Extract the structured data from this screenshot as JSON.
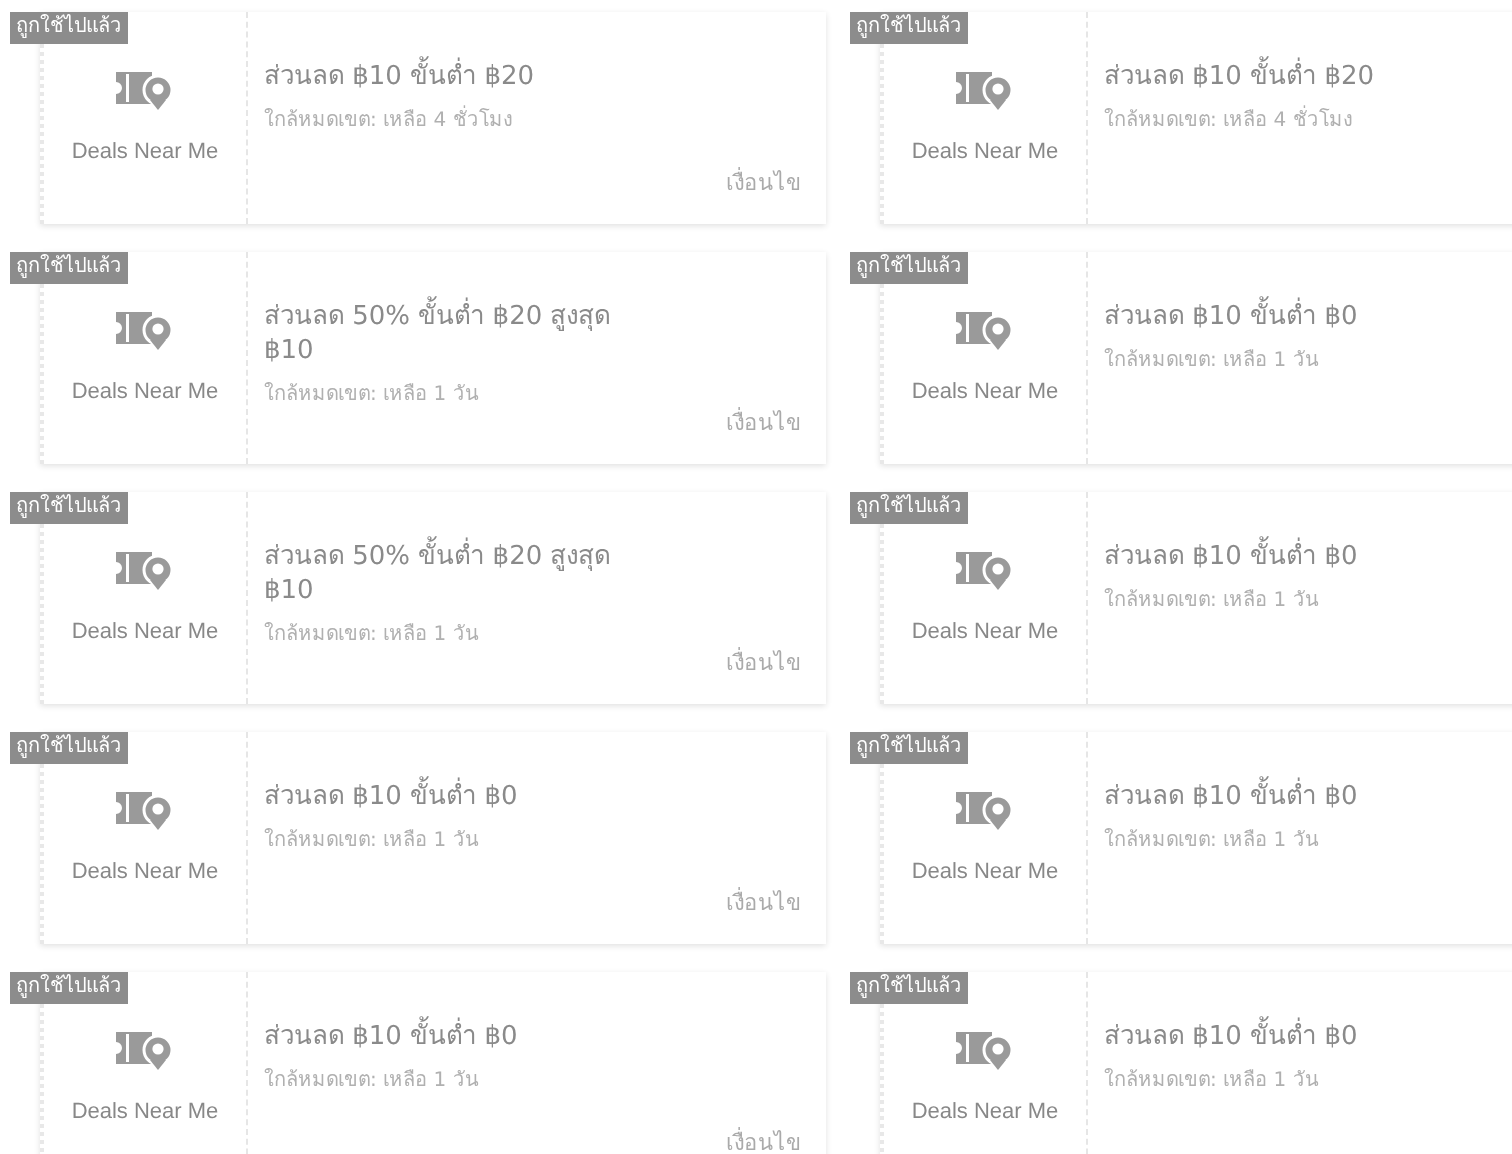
{
  "vouchers": [
    {
      "badge": "ถูกใช้ไปแล้ว",
      "brand": "Deals Near Me",
      "title": "ส่วนลด ฿10 ขั้นต่ำ ฿20",
      "expiry": "ใกล้หมดเขต: เหลือ 4 ชั่วโมง",
      "condition": "เงื่อนไข"
    },
    {
      "badge": "ถูกใช้ไปแล้ว",
      "brand": "Deals Near Me",
      "title": "ส่วนลด ฿10 ขั้นต่ำ ฿20",
      "expiry": "ใกล้หมดเขต: เหลือ 4 ชั่วโมง"
    },
    {
      "badge": "ถูกใช้ไปแล้ว",
      "brand": "Deals Near Me",
      "title": "ส่วนลด 50% ขั้นต่ำ ฿20 สูงสุด ฿10",
      "expiry": "ใกล้หมดเขต: เหลือ 1 วัน",
      "condition": "เงื่อนไข"
    },
    {
      "badge": "ถูกใช้ไปแล้ว",
      "brand": "Deals Near Me",
      "title": "ส่วนลด ฿10 ขั้นต่ำ ฿0",
      "expiry": "ใกล้หมดเขต: เหลือ 1 วัน"
    },
    {
      "badge": "ถูกใช้ไปแล้ว",
      "brand": "Deals Near Me",
      "title": "ส่วนลด 50% ขั้นต่ำ ฿20 สูงสุด ฿10",
      "expiry": "ใกล้หมดเขต: เหลือ 1 วัน",
      "condition": "เงื่อนไข"
    },
    {
      "badge": "ถูกใช้ไปแล้ว",
      "brand": "Deals Near Me",
      "title": "ส่วนลด ฿10 ขั้นต่ำ ฿0",
      "expiry": "ใกล้หมดเขต: เหลือ 1 วัน"
    },
    {
      "badge": "ถูกใช้ไปแล้ว",
      "brand": "Deals Near Me",
      "title": "ส่วนลด ฿10 ขั้นต่ำ ฿0",
      "expiry": "ใกล้หมดเขต: เหลือ 1 วัน",
      "condition": "เงื่อนไข"
    },
    {
      "badge": "ถูกใช้ไปแล้ว",
      "brand": "Deals Near Me",
      "title": "ส่วนลด ฿10 ขั้นต่ำ ฿0",
      "expiry": "ใกล้หมดเขต: เหลือ 1 วัน"
    },
    {
      "badge": "ถูกใช้ไปแล้ว",
      "brand": "Deals Near Me",
      "title": "ส่วนลด ฿10 ขั้นต่ำ ฿0",
      "expiry": "ใกล้หมดเขต: เหลือ 1 วัน",
      "condition": "เงื่อนไข"
    },
    {
      "badge": "ถูกใช้ไปแล้ว",
      "brand": "Deals Near Me",
      "title": "ส่วนลด ฿10 ขั้นต่ำ ฿0",
      "expiry": "ใกล้หมดเขต: เหลือ 1 วัน"
    }
  ]
}
